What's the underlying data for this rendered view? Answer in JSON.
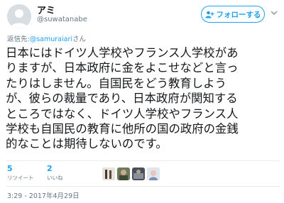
{
  "user": {
    "display_name": "アミ",
    "handle": "@suwatanabe"
  },
  "follow_button": {
    "label": "フォローする",
    "icon": "add-user-icon"
  },
  "more_menu": {
    "icon": "chevron-down-icon"
  },
  "reply_to": {
    "prefix": "返信先:",
    "mention": "@samuraiari",
    "suffix": "さん"
  },
  "tweet": {
    "text": "日本にはドイツ人学校やフランス人学校があ\nりますが、日本政府に金をよこせなどと言っ\nたりはしません。自国民をどう教育しよう\nが、彼らの裁量であり、日本政府が関知する\nところではなく、ドイツ人学校やフランス人\n学校も自国民の教育に他所の国の政府の金銭\n的なことは期待しないのです。"
  },
  "stats": {
    "retweets": {
      "count": "5",
      "label": "リツイート"
    },
    "likes": {
      "count": "2",
      "label": "いいね"
    }
  },
  "likers": [
    "liker-avatar-1",
    "liker-avatar-2",
    "liker-avatar-3",
    "liker-avatar-4"
  ],
  "timestamp": "3:29 - 2017年4月29日",
  "colors": {
    "accent": "#1da1f2",
    "text": "#14171a",
    "muted": "#657786",
    "divider": "#e6ecf0"
  }
}
